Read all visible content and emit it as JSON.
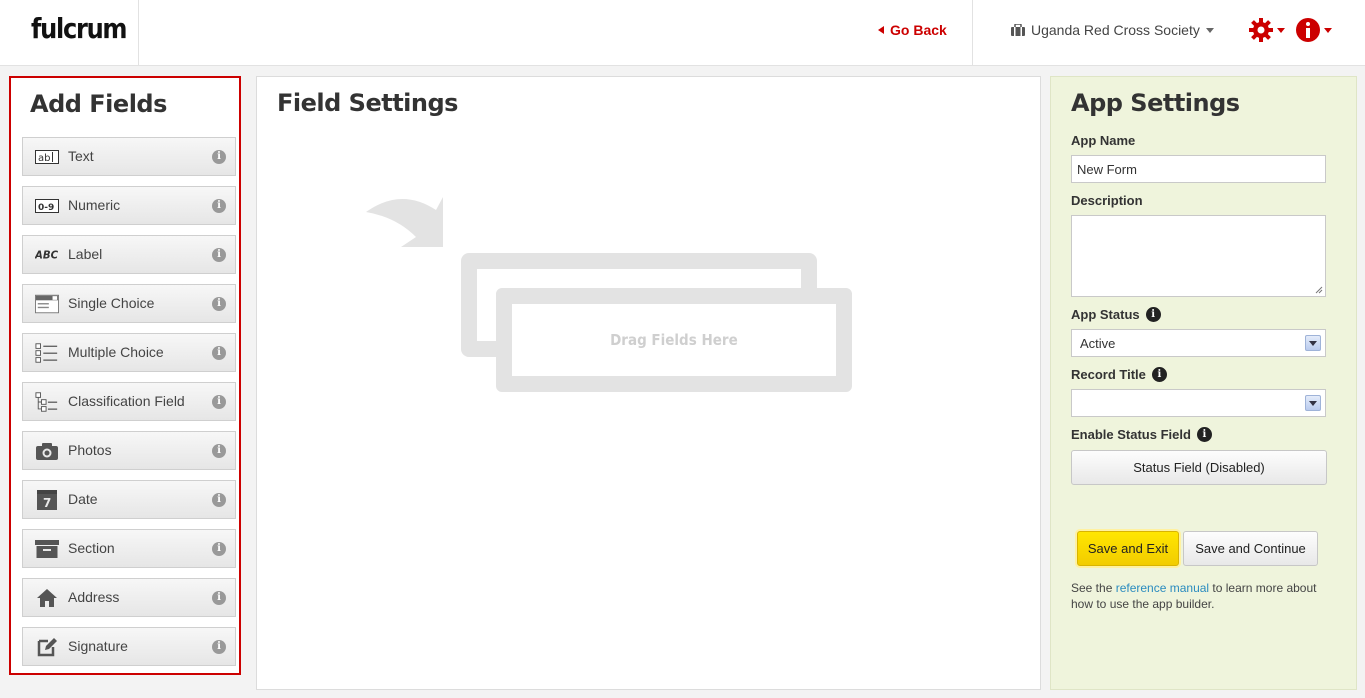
{
  "header": {
    "logo": "fulcrum",
    "go_back": "Go Back",
    "organization": "Uganda Red Cross Society"
  },
  "add_fields": {
    "title": "Add Fields",
    "items": [
      {
        "label": "Text",
        "icon": "text-field-icon"
      },
      {
        "label": "Numeric",
        "icon": "numeric-field-icon"
      },
      {
        "label": "Label",
        "icon": "label-field-icon"
      },
      {
        "label": "Single Choice",
        "icon": "single-choice-icon"
      },
      {
        "label": "Multiple Choice",
        "icon": "multiple-choice-icon"
      },
      {
        "label": "Classification Field",
        "icon": "classification-icon"
      },
      {
        "label": "Photos",
        "icon": "camera-icon"
      },
      {
        "label": "Date",
        "icon": "calendar-icon"
      },
      {
        "label": "Section",
        "icon": "section-icon"
      },
      {
        "label": "Address",
        "icon": "home-icon"
      },
      {
        "label": "Signature",
        "icon": "signature-icon"
      }
    ]
  },
  "field_settings": {
    "title": "Field Settings",
    "drop_text": "Drag Fields Here"
  },
  "app_settings": {
    "title": "App Settings",
    "app_name_label": "App Name",
    "app_name_value": "New Form",
    "description_label": "Description",
    "app_status_label": "App Status",
    "app_status_value": "Active",
    "record_title_label": "Record Title",
    "record_title_value": "",
    "enable_status_label": "Enable Status Field",
    "status_button": "Status Field (Disabled)",
    "save_exit": "Save and Exit",
    "save_continue": "Save and Continue",
    "note_prefix": "See the ",
    "note_link": "reference manual",
    "note_suffix": " to learn more about how to use the app builder."
  },
  "colors": {
    "accent_red": "#cc0000",
    "save_yellow": "#ffe600",
    "settings_bg": "#eff4dc"
  }
}
